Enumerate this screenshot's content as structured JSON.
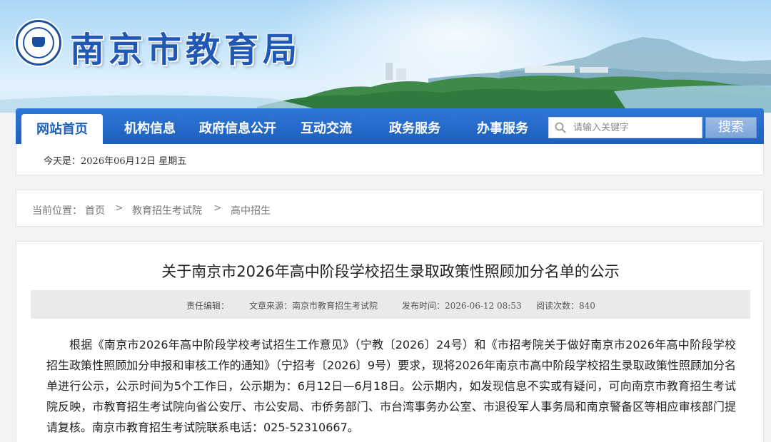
{
  "site": {
    "title": "南京市教育局",
    "logo_icon": "nanjing-education-emblem-icon"
  },
  "nav": {
    "items": [
      {
        "label": "网站首页",
        "active": true
      },
      {
        "label": "机构信息"
      },
      {
        "label": "政府信息公开"
      },
      {
        "label": "互动交流"
      },
      {
        "label": "政务服务"
      },
      {
        "label": "办事服务"
      }
    ],
    "search": {
      "placeholder": "请输入关键字",
      "button_label": "搜索",
      "icon": "search-icon"
    }
  },
  "date_bar": {
    "text": "今天是：2026年06月12日  星期五"
  },
  "breadcrumb": {
    "prefix": "当前位置：",
    "items": [
      "首页",
      "教育招生考试院",
      "高中招生"
    ],
    "separator": ">"
  },
  "article": {
    "title": "关于南京市2026年高中阶段学校招生录取政策性照顾加分名单的公示",
    "meta": {
      "editor": "责任编辑：",
      "source": "文章来源：南京市教育招生考试院",
      "published": "发布时间：2026-06-12 08:53",
      "views": "阅读次数：840"
    },
    "body": "根据《南京市2026年高中阶段学校考试招生工作意见》（宁教〔2026〕24号）和《市招考院关于做好南京市2026年高中阶段学校招生政策性照顾加分申报和审核工作的通知》（宁招考〔2026〕9号）要求，现将2026年南京市高中阶段学校招生录取政策性照顾加分名单进行公示，公示时间为5个工作日，公示期为：6月12日—6月18日。公示期内，如发现信息不实或有疑问，可向南京市教育招生考试院反映，市教育招生考试院向省公安厅、市公安局、市侨务部门、市台湾事务办公室、市退役军人事务局和南京警备区等相应审核部门提请复核。南京市教育招生考试院联系电话：025-52310667。"
  },
  "colors": {
    "brand_blue": "#1d5fbd",
    "title_blue": "#1f58b5",
    "page_bg": "#f2f3f5",
    "meta_bg": "#e9eaec"
  }
}
